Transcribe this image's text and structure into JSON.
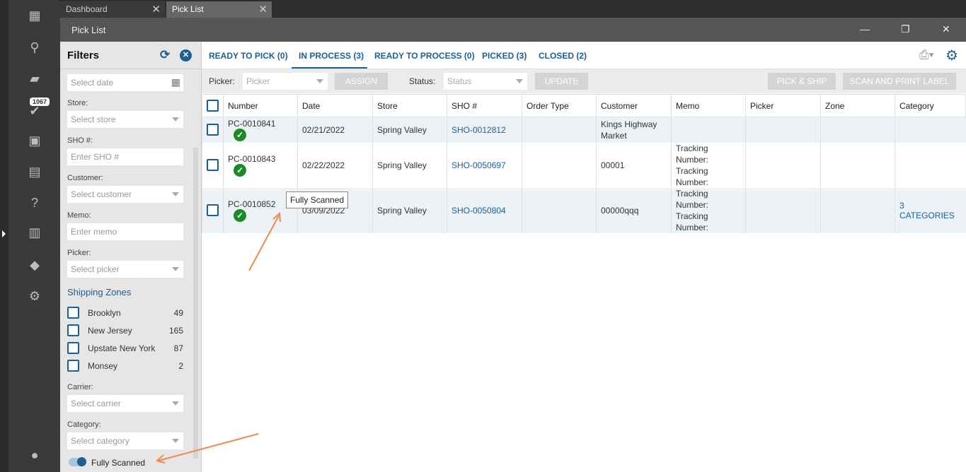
{
  "window_tabs": [
    {
      "label": "Dashboard"
    },
    {
      "label": "Pick List"
    }
  ],
  "window_title": "Pick List",
  "sidebar": {
    "badge": "1067"
  },
  "filters": {
    "title": "Filters",
    "date_placeholder": "Select date",
    "store_label": "Store:",
    "store_placeholder": "Select store",
    "sho_label": "SHO #:",
    "sho_placeholder": "Enter SHO #",
    "customer_label": "Customer:",
    "customer_placeholder": "Select customer",
    "memo_label": "Memo:",
    "memo_placeholder": "Enter memo",
    "picker_label": "Picker:",
    "picker_placeholder": "Select picker",
    "zones_title": "Shipping Zones",
    "zones": [
      {
        "name": "Brooklyn",
        "count": "49"
      },
      {
        "name": "New Jersey",
        "count": "165"
      },
      {
        "name": "Upstate New York",
        "count": "87"
      },
      {
        "name": "Monsey",
        "count": "2"
      }
    ],
    "carrier_label": "Carrier:",
    "carrier_placeholder": "Select carrier",
    "category_label": "Category:",
    "category_placeholder": "Select category",
    "fully_scanned": "Fully Scanned"
  },
  "tabs": [
    {
      "label": "READY TO PICK (0)"
    },
    {
      "label": "IN PROCESS (3)"
    },
    {
      "label": "READY TO PROCESS (0)"
    },
    {
      "label": "PICKED (3)"
    },
    {
      "label": "CLOSED (2)"
    }
  ],
  "toolbar": {
    "picker_label": "Picker:",
    "picker_placeholder": "Picker",
    "assign": "ASSIGN",
    "status_label": "Status:",
    "status_placeholder": "Status",
    "update": "UPDATE",
    "pick_ship": "PICK & SHIP",
    "scan_print": "SCAN AND PRINT LABEL"
  },
  "table": {
    "columns": [
      "Number",
      "Date",
      "Store",
      "SHO #",
      "Order Type",
      "Customer",
      "Memo",
      "Picker",
      "Zone",
      "Category"
    ],
    "rows": [
      {
        "number": "PC-0010841",
        "date": "02/21/2022",
        "store": "Spring Valley",
        "sho": "SHO-0012812",
        "order_type": "",
        "customer": "Kings Highway Market",
        "memo1": "",
        "memo2": "",
        "picker": "",
        "zone": "",
        "category": ""
      },
      {
        "number": "PC-0010843",
        "date": "02/22/2022",
        "store": "Spring Valley",
        "sho": "SHO-0050697",
        "order_type": "",
        "customer": "00001",
        "memo1": "Tracking Number:",
        "memo2": "Tracking Number:",
        "picker": "",
        "zone": "",
        "category": ""
      },
      {
        "number": "PC-0010852",
        "date": "03/09/2022",
        "store": "Spring Valley",
        "sho": "SHO-0050804",
        "order_type": "",
        "customer": "00000qqq",
        "memo1": "Tracking Number:",
        "memo2": "Tracking Number:",
        "picker": "",
        "zone": "",
        "category": "3 CATEGORIES"
      }
    ]
  },
  "tooltip": "Fully Scanned",
  "colors": {
    "accent": "#1a5f96",
    "success": "#1a8a2a",
    "annotation": "#f08a4b"
  }
}
